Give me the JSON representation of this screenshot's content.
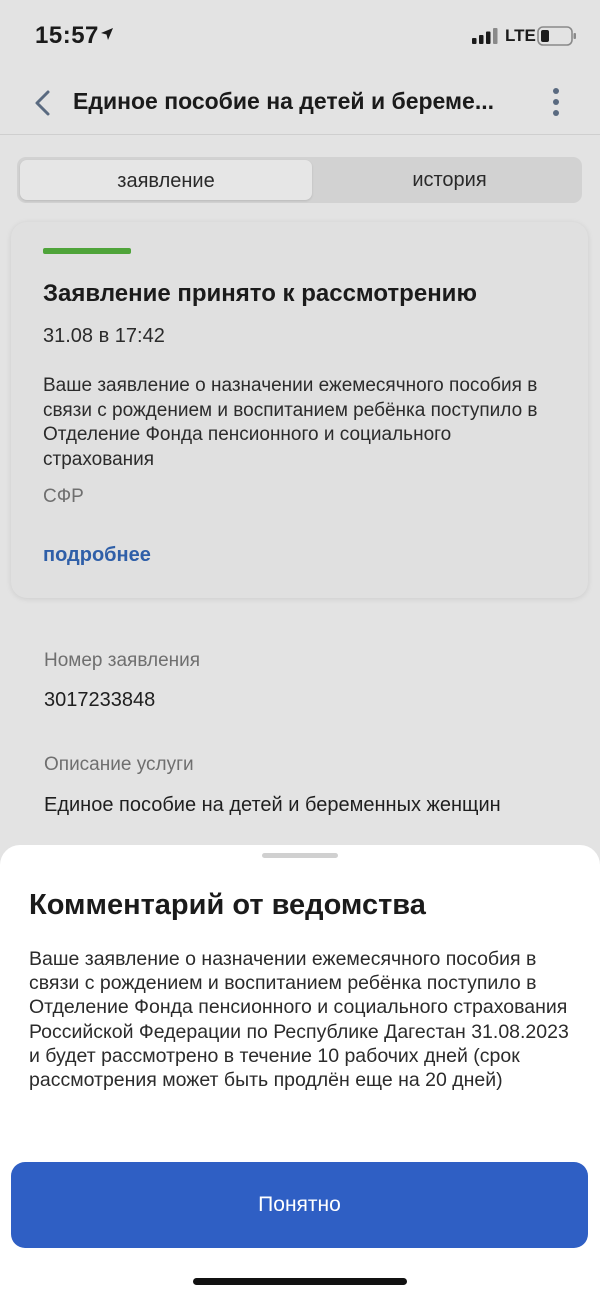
{
  "status_bar": {
    "time": "15:57",
    "network": "LTE"
  },
  "header": {
    "title": "Единое пособие на детей и береме..."
  },
  "tabs": [
    {
      "label": "заявление",
      "active": true
    },
    {
      "label": "история",
      "active": false
    }
  ],
  "status_card": {
    "title": "Заявление принято к рассмотрению",
    "date": "31.08 в 17:42",
    "text": "Ваше заявление о назначении ежемесячного пособия в связи с рождением и воспитанием ребёнка поступило в Отделение Фонда пенсионного и социального страхования",
    "source": "СФР",
    "more_link": "подробнее",
    "status_color": "#4fa43a"
  },
  "details": {
    "number_label": "Номер заявления",
    "number_value": "3017233848",
    "service_label": "Описание услуги",
    "service_value": "Единое пособие на детей и беременных женщин"
  },
  "sheet": {
    "title": "Комментарий от ведомства",
    "text": "Ваше заявление о назначении ежемесячного пособия в связи с рождением и воспитанием ребёнка поступило в Отделение Фонда пенсионного и социального страхования Российской Федерации по Республике Дагестан 31.08.2023 и будет рассмотрено в течение 10 рабочих дней (срок рассмотрения может быть продлён еще на 20 дней)",
    "button_label": "Понятно"
  },
  "colors": {
    "accent": "#2f5fc4",
    "link": "#2f5fa8"
  }
}
